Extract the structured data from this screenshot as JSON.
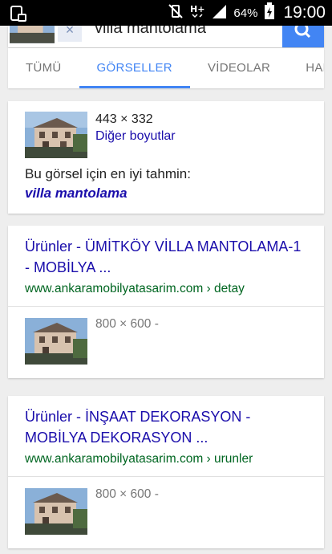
{
  "status_bar": {
    "battery_pct": "64%",
    "time": "19:00",
    "network": "H+"
  },
  "search": {
    "query": "villa mantolama"
  },
  "tabs": [
    {
      "label": "TÜMÜ"
    },
    {
      "label": "GÖRSELLER"
    },
    {
      "label": "VİDEOLAR"
    },
    {
      "label": "HABE"
    }
  ],
  "best_guess": {
    "dimensions": "443 × 332",
    "other_sizes": "Diğer boyutlar",
    "label": "Bu görsel için en iyi tahmin:",
    "value": "villa mantolama"
  },
  "results": [
    {
      "title": "Ürünler - ÜMİTKÖY VİLLA MANTOLAMA-1 - MOBİLYA ...",
      "url": "www.ankaramobilyatasarim.com › detay",
      "image_size": "800 × 600 -"
    },
    {
      "title": "Ürünler - İNŞAAT DEKORASYON - MOBİLYA DEKORASYON ...",
      "url": "www.ankaramobilyatasarim.com › urunler",
      "image_size": "800 × 600 -"
    }
  ],
  "colors": {
    "accent": "#4285f4",
    "link": "#1a0dab",
    "url": "#006621"
  }
}
